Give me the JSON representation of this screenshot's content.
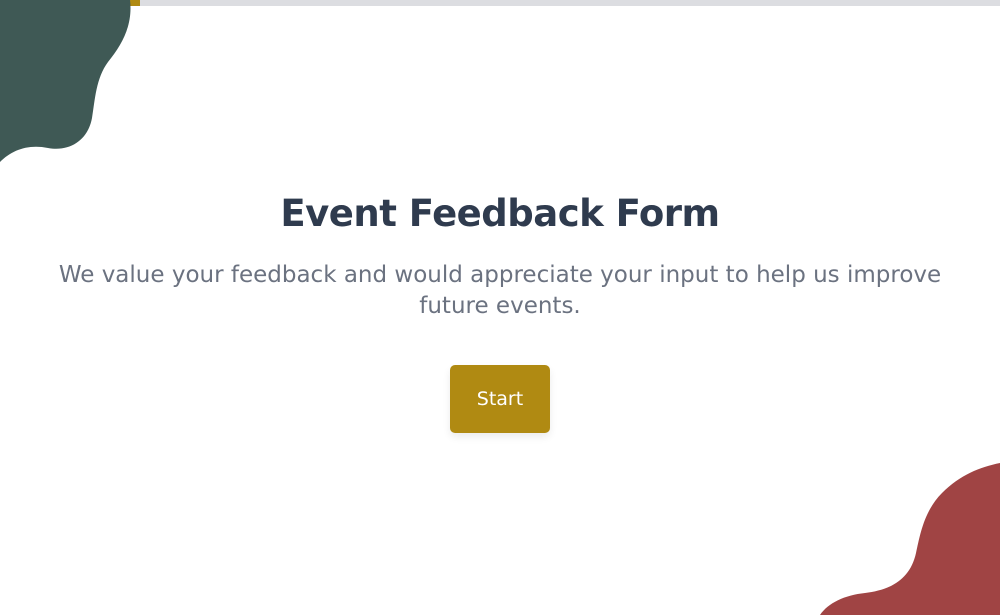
{
  "progress": {
    "value_fraction": 0.14,
    "fill_color": "#b08a12",
    "track_color": "#dcdde1"
  },
  "decorations": {
    "top_left_blob_color": "#3f5955",
    "bottom_right_blob_color": "#a04444"
  },
  "form": {
    "title": "Event Feedback Form",
    "description": "We value your feedback and would appreciate your input to help us improve future events.",
    "start_label": "Start"
  },
  "colors": {
    "accent": "#b08a12",
    "title": "#2f3b4e",
    "description": "#6b7280"
  }
}
